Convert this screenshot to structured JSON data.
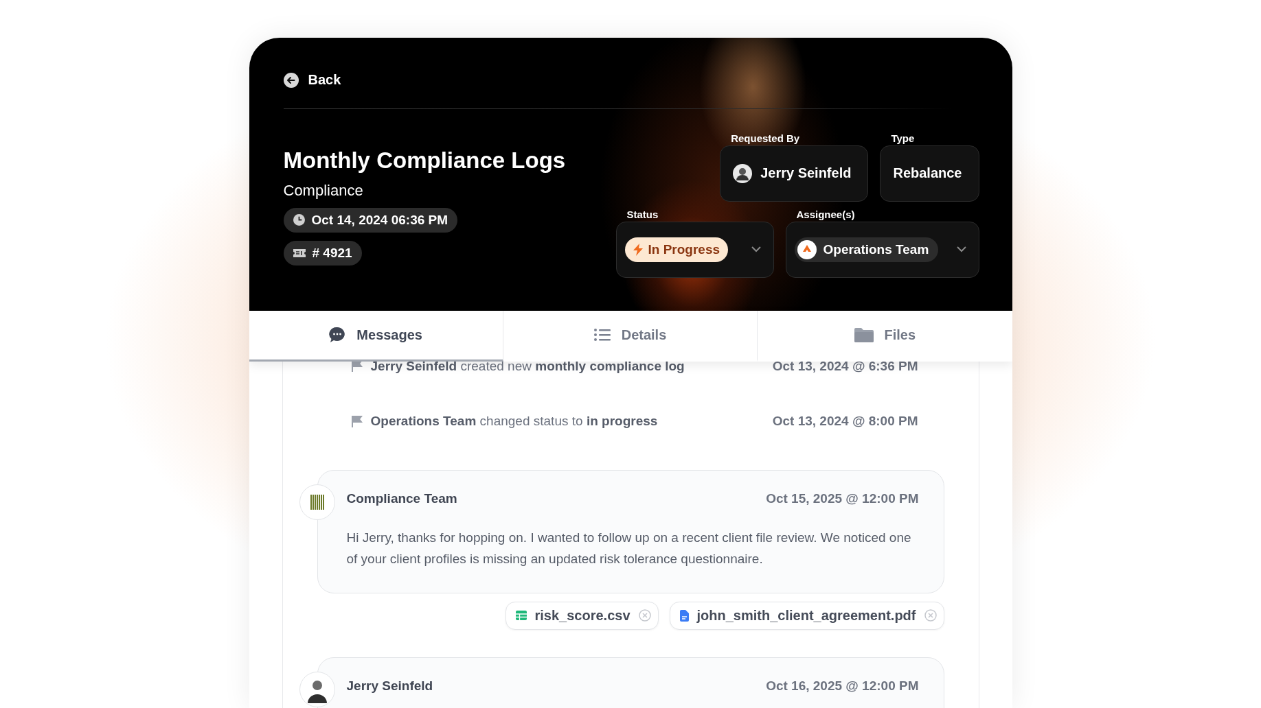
{
  "back": {
    "label": "Back"
  },
  "request": {
    "title": "Monthly Compliance Logs",
    "category": "Compliance",
    "created": "Oct 14, 2024 06:36 PM",
    "ticket": "# 4921"
  },
  "fields": [
    {
      "kind": "person",
      "label": "Requested By",
      "value": "Jerry Seinfeld"
    },
    {
      "kind": "text",
      "label": "Type",
      "value": "Rebalance"
    }
  ],
  "status": {
    "label": "Status",
    "value": "In Progress"
  },
  "assignees": {
    "label": "Assignee(s)",
    "value": "Operations Team"
  },
  "tabs": [
    {
      "kind": "chat",
      "label": "Messages",
      "selected": true
    },
    {
      "kind": "list",
      "label": "Details",
      "selected": false
    },
    {
      "kind": "folder",
      "label": "Files",
      "selected": false
    }
  ],
  "activity": [
    {
      "text": "**Jerry Seinfeld** created new **monthly compliance log**",
      "time": "Oct 13, 2024 @ 6:36 PM"
    },
    {
      "text": "**Operations Team** changed status to **in progress**",
      "time": "Oct 13, 2024 @ 8:00 PM"
    }
  ],
  "messages": [
    {
      "kind": "logo",
      "author": "Compliance Team",
      "time": "Oct 15, 2025 @ 12:00 PM",
      "text": "Hi Jerry, thanks for hopping on. I wanted to follow up on a recent client file review. We noticed one of your client profiles is missing an updated risk tolerance questionnaire.",
      "attachments": [
        {
          "kind": "sheet",
          "name": "risk_score.csv"
        },
        {
          "kind": "doc",
          "name": "john_smith_client_agreement.pdf"
        }
      ]
    },
    {
      "kind": "person",
      "author": "Jerry Seinfeld",
      "time": "Oct 16, 2025 @ 12:00 PM"
    }
  ]
}
